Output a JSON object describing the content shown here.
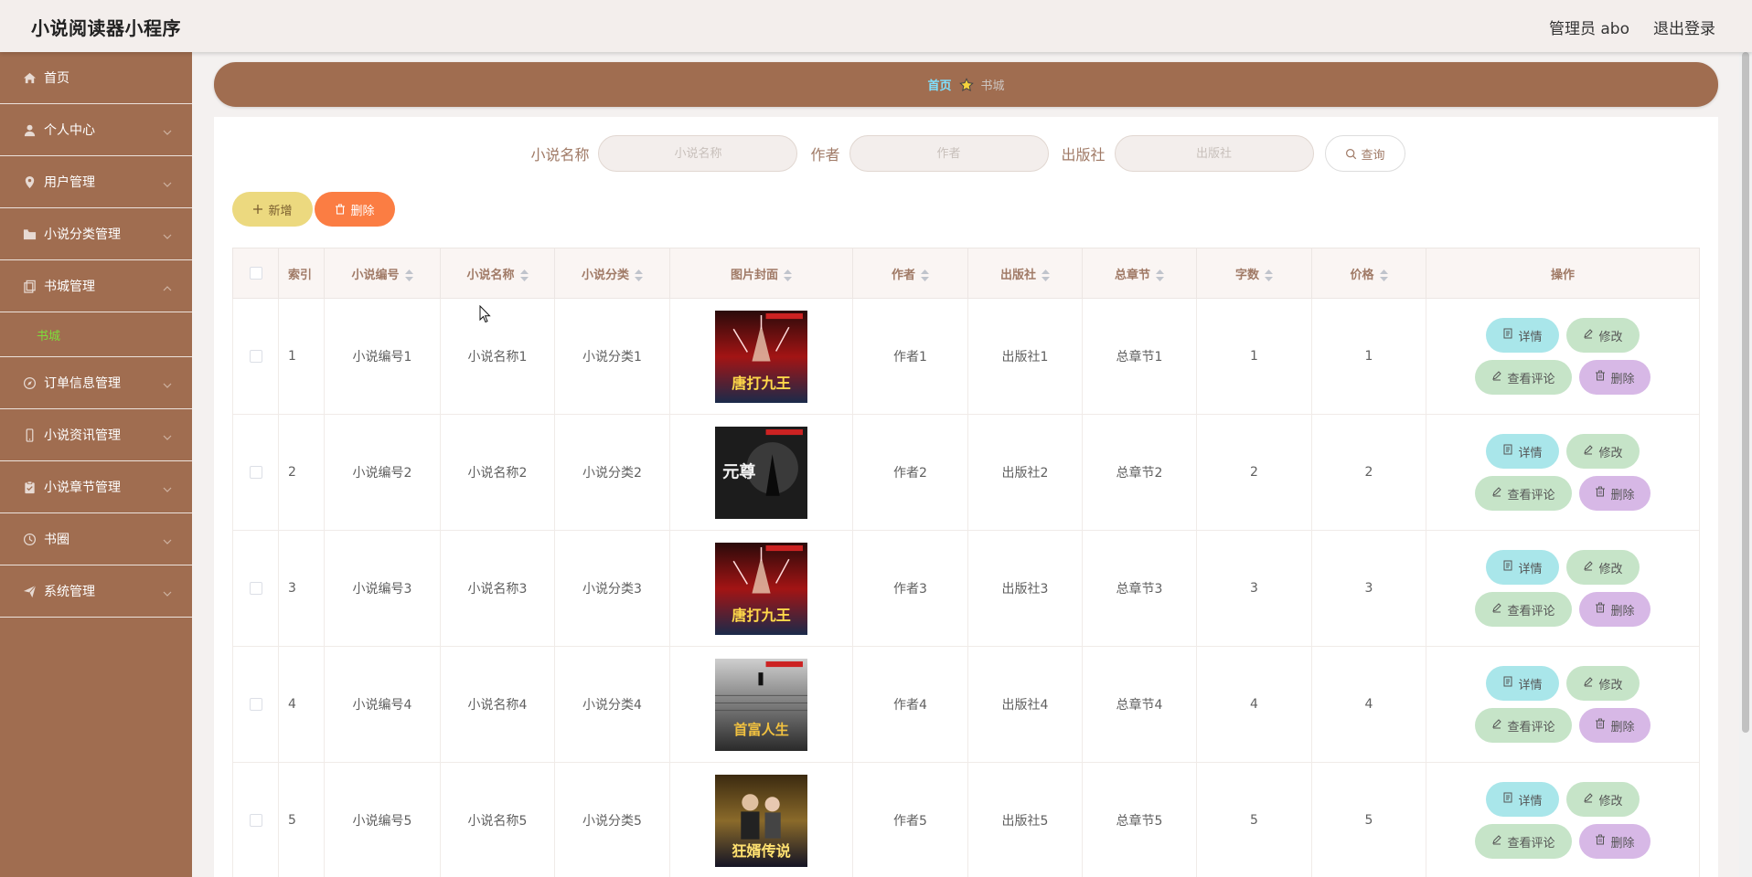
{
  "header": {
    "title": "小说阅读器小程序",
    "user_label": "管理员 abo",
    "logout_label": "退出登录"
  },
  "sidebar": {
    "items": [
      {
        "label": "首页",
        "icon": "home-icon",
        "chevron": false
      },
      {
        "label": "个人中心",
        "icon": "user-icon",
        "chevron": true
      },
      {
        "label": "用户管理",
        "icon": "location-icon",
        "chevron": true
      },
      {
        "label": "小说分类管理",
        "icon": "folder-icon",
        "chevron": true
      },
      {
        "label": "书城管理",
        "icon": "copy-icon",
        "chevron": true,
        "expanded": true
      },
      {
        "label": "订单信息管理",
        "icon": "compass-icon",
        "chevron": true
      },
      {
        "label": "小说资讯管理",
        "icon": "phone-icon",
        "chevron": true
      },
      {
        "label": "小说章节管理",
        "icon": "clipboard-icon",
        "chevron": true
      },
      {
        "label": "书圈",
        "icon": "clock-icon",
        "chevron": true
      },
      {
        "label": "系统管理",
        "icon": "send-icon",
        "chevron": true
      }
    ],
    "sub_item": "书城"
  },
  "breadcrumb": {
    "home": "首页",
    "current": "书城"
  },
  "search": {
    "novel_name_label": "小说名称",
    "novel_name_placeholder": "小说名称",
    "author_label": "作者",
    "author_placeholder": "作者",
    "publisher_label": "出版社",
    "publisher_placeholder": "出版社",
    "query_label": "查询"
  },
  "actions": {
    "add_label": "新增",
    "delete_label": "删除"
  },
  "table": {
    "headers": {
      "index": "索引",
      "code": "小说编号",
      "name": "小说名称",
      "category": "小说分类",
      "cover": "图片封面",
      "author": "作者",
      "publisher": "出版社",
      "chapters": "总章节",
      "words": "字数",
      "price": "价格",
      "ops": "操作"
    },
    "op_labels": {
      "detail": "详情",
      "edit": "修改",
      "review": "查看评论",
      "delete": "删除"
    },
    "rows": [
      {
        "index": "1",
        "code": "小说编号1",
        "name": "小说名称1",
        "category": "小说分类1",
        "author": "作者1",
        "publisher": "出版社1",
        "chapters": "总章节1",
        "words": "1",
        "price": "1",
        "cover_text": "唐打九王",
        "cover_style": "red"
      },
      {
        "index": "2",
        "code": "小说编号2",
        "name": "小说名称2",
        "category": "小说分类2",
        "author": "作者2",
        "publisher": "出版社2",
        "chapters": "总章节2",
        "words": "2",
        "price": "2",
        "cover_text": "元尊",
        "cover_style": "dark"
      },
      {
        "index": "3",
        "code": "小说编号3",
        "name": "小说名称3",
        "category": "小说分类3",
        "author": "作者3",
        "publisher": "出版社3",
        "chapters": "总章节3",
        "words": "3",
        "price": "3",
        "cover_text": "唐打九王",
        "cover_style": "red"
      },
      {
        "index": "4",
        "code": "小说编号4",
        "name": "小说名称4",
        "category": "小说分类4",
        "author": "作者4",
        "publisher": "出版社4",
        "chapters": "总章节4",
        "words": "4",
        "price": "4",
        "cover_text": "首富人生",
        "cover_style": "gray"
      },
      {
        "index": "5",
        "code": "小说编号5",
        "name": "小说名称5",
        "category": "小说分类5",
        "author": "作者5",
        "publisher": "出版社5",
        "chapters": "总章节5",
        "words": "5",
        "price": "5",
        "cover_text": "狂婿传说",
        "cover_style": "gold"
      }
    ]
  },
  "colors": {
    "sidebar_bg": "#a06d50",
    "accent_green": "#7dde3a",
    "crumb_home": "#7fe0ff"
  }
}
